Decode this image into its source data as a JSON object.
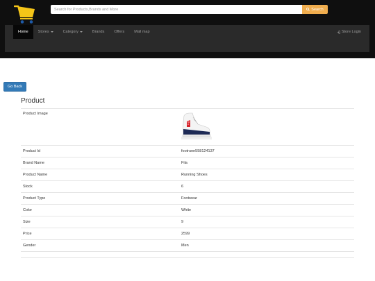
{
  "header": {
    "search_placeholder": "Search for Products,Brands and More",
    "search_button_label": "Search",
    "accent_color": "#f0ad4e"
  },
  "nav": {
    "items": [
      {
        "label": "Home",
        "active": true,
        "dropdown": false
      },
      {
        "label": "Stores",
        "active": false,
        "dropdown": true
      },
      {
        "label": "Category",
        "active": false,
        "dropdown": true
      },
      {
        "label": "Brands",
        "active": false,
        "dropdown": false
      },
      {
        "label": "Offers",
        "active": false,
        "dropdown": false
      },
      {
        "label": "Mall map",
        "active": false,
        "dropdown": false
      }
    ],
    "store_login_label": "Store Login"
  },
  "go_back_label": "Go Back",
  "product": {
    "title": "Product",
    "image_label": "Product Image",
    "rows": [
      {
        "label": "Product Id",
        "value": "footrunn558124137"
      },
      {
        "label": "Brand Name",
        "value": "Fila"
      },
      {
        "label": "Product Name",
        "value": "Running Shoes"
      },
      {
        "label": "Stock",
        "value": "6"
      },
      {
        "label": "Product Type",
        "value": "Footwear"
      },
      {
        "label": "Color",
        "value": "White"
      },
      {
        "label": "Size",
        "value": "9"
      },
      {
        "label": "Price",
        "value": "2599"
      },
      {
        "label": "Gender",
        "value": "Men"
      }
    ]
  }
}
